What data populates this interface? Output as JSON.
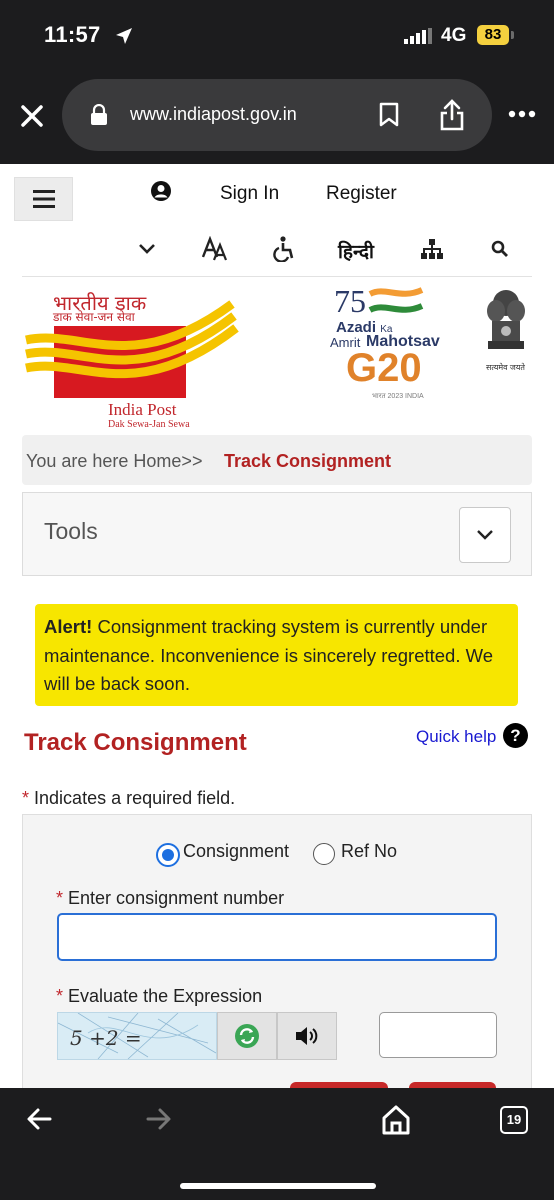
{
  "status_bar": {
    "time": "11:57",
    "network": "4G",
    "battery": "83"
  },
  "browser": {
    "url": "www.indiapost.gov.in",
    "tab_count": "19"
  },
  "header": {
    "sign_in": "Sign In",
    "register": "Register",
    "hindi": "हिन्दी"
  },
  "logos": {
    "ip_hindi": "भारतीय डाक",
    "ip_hindi_sub": "डाक सेवा-जन सेवा",
    "ip_name": "India Post",
    "ip_tagline": "Dak Sewa-Jan Sewa",
    "azadi_1": "Azadi",
    "azadi_ka": "Ka",
    "azadi_amrit": "Amrit",
    "azadi_mahotsav": "Mahotsav",
    "g20": "G20",
    "g20_sub": "भारत 2023 INDIA",
    "emblem_motto": "सत्यमेव जयते"
  },
  "breadcrumb": {
    "prefix": "You are here Home>>",
    "current": "Track Consignment"
  },
  "tools": {
    "label": "Tools"
  },
  "alert": {
    "strong": "Alert!",
    "message": "Consignment tracking system is currently under maintenance. Inconvenience is sincerely regretted. We will be back soon."
  },
  "form": {
    "heading": "Track Consignment",
    "quick_help": "Quick help",
    "help_icon": "?",
    "required_marker": "*",
    "required_note": "Indicates a required field.",
    "radio_consignment": "Consignment",
    "radio_ref": "Ref No",
    "selected_radio": "Consignment",
    "number_label": "Enter consignment number",
    "number_value": "",
    "captcha_label": "Evaluate the Expression",
    "captcha_expression": "5 +2 =",
    "captcha_value": ""
  },
  "icons": {
    "close": "close-icon",
    "lock": "lock-icon",
    "bookmark": "bookmark-icon",
    "share": "share-icon",
    "more": "more-icon",
    "menu": "hamburger-icon",
    "user": "user-icon",
    "chevron": "chevron-down-icon",
    "font_size": "font-size-icon",
    "accessibility": "accessibility-icon",
    "sitemap": "sitemap-icon",
    "search": "search-icon",
    "refresh": "refresh-icon",
    "audio": "speaker-icon",
    "back": "back-arrow-icon",
    "forward": "forward-arrow-icon",
    "home": "home-icon"
  },
  "colors": {
    "brand_red": "#c1272d",
    "alert_yellow": "#f7e600",
    "link_blue": "#1a1ad1",
    "focus_blue": "#2a6fd6"
  }
}
